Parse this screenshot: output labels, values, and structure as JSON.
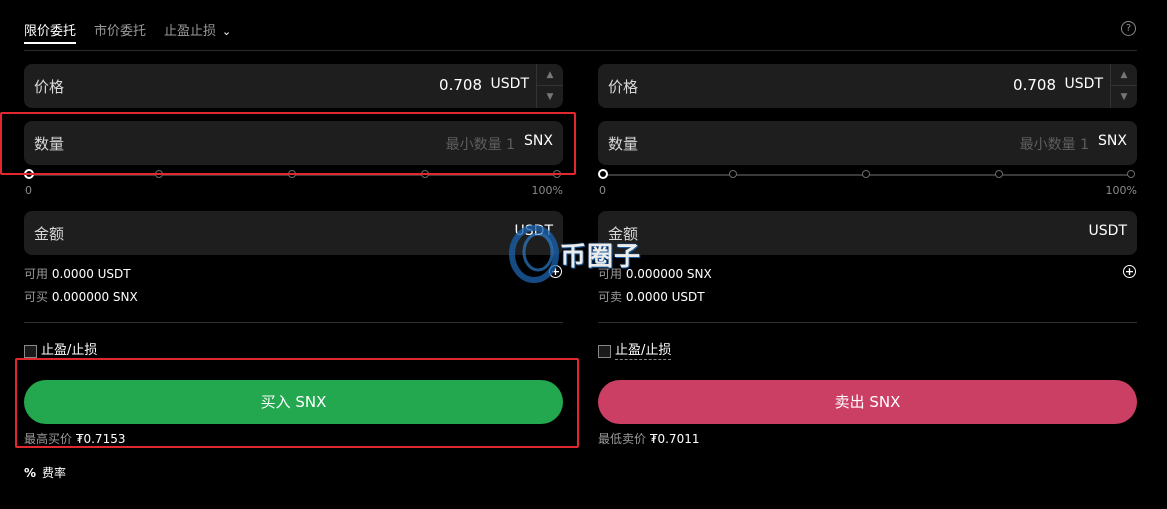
{
  "tabs": [
    {
      "label": "限价委托",
      "active": true
    },
    {
      "label": "市价委托",
      "active": false
    },
    {
      "label": "止盈止损",
      "active": false
    }
  ],
  "icons": {
    "dropdown": "chevron-down-icon",
    "help": "help-circle-icon",
    "deposit": "plus-circle-icon",
    "fee": "percent-icon"
  },
  "buy_panel": {
    "price_label": "价格",
    "price_value": "0.708",
    "price_unit": "USDT",
    "quantity_label": "数量",
    "quantity_placeholder": "最小数量 1",
    "quantity_unit": "SNX",
    "slider_position": 0,
    "slider_min": "0",
    "slider_max": "100%",
    "amount_label": "金额",
    "amount_unit": "USDT",
    "available_label": "可用",
    "available_value": "0.0000 USDT",
    "can_label": "可买",
    "can_value": "0.000000 SNX",
    "tpsl_label": "止盈/止损",
    "tpsl_checked": false,
    "action_label": "买入 SNX",
    "best_label": "最高买价",
    "best_value": "₮0.7153"
  },
  "sell_panel": {
    "price_label": "价格",
    "price_value": "0.708",
    "price_unit": "USDT",
    "quantity_label": "数量",
    "quantity_placeholder": "最小数量 1",
    "quantity_unit": "SNX",
    "slider_position": 0,
    "slider_min": "0",
    "slider_max": "100%",
    "amount_label": "金额",
    "amount_unit": "USDT",
    "available_label": "可用",
    "available_value": "0.000000 SNX",
    "can_label": "可卖",
    "can_value": "0.0000 USDT",
    "tpsl_label": "止盈/止损",
    "tpsl_checked": false,
    "action_label": "卖出 SNX",
    "best_label": "最低卖价",
    "best_value": "₮0.7011"
  },
  "fee": {
    "symbol": "%",
    "label": "费率"
  },
  "watermark": {
    "text": "币圈子"
  },
  "colors": {
    "buy": "#23a74f",
    "sell": "#cc3f65",
    "highlight": "#e0282e",
    "background": "#000000",
    "field": "#1e1e1e"
  }
}
